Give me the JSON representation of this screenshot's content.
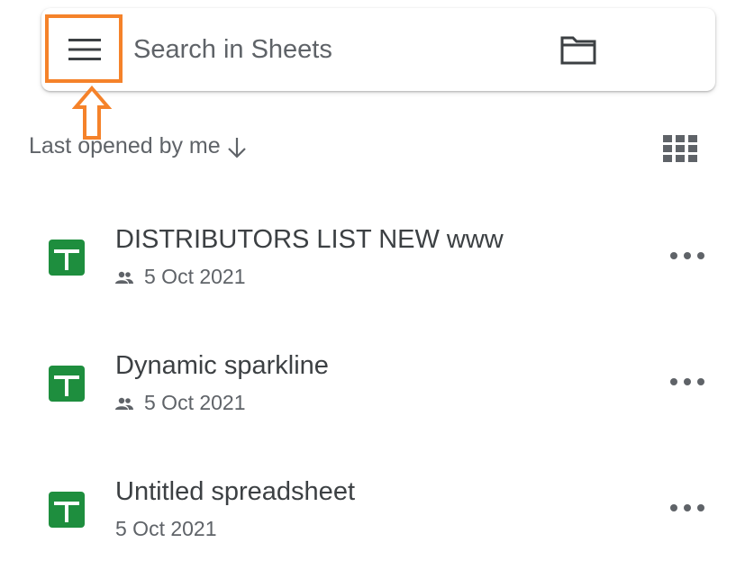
{
  "search": {
    "placeholder": "Search in Sheets",
    "value": ""
  },
  "sort": {
    "label": "Last opened by me",
    "direction": "descending"
  },
  "files": [
    {
      "name": "DISTRIBUTORS LIST NEW www",
      "date": "5 Oct 2021",
      "shared": true
    },
    {
      "name": "Dynamic sparkline",
      "date": "5 Oct 2021",
      "shared": true
    },
    {
      "name": "Untitled spreadsheet",
      "date": "5 Oct 2021",
      "shared": false
    }
  ],
  "icons": {
    "menu": "hamburger-menu-icon",
    "folder": "folder-icon",
    "sort": "arrow-down-icon",
    "view": "grid-view-icon",
    "file": "sheets-file-icon",
    "shared": "people-icon",
    "more": "more-horizontal-icon"
  },
  "colors": {
    "highlight": "#f5822a",
    "sheets_green": "#1e8e3e",
    "text_primary": "#3c4043",
    "text_secondary": "#5f6368"
  }
}
